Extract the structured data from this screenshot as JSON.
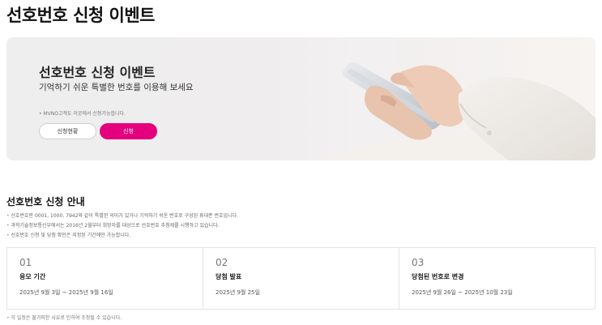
{
  "page": {
    "title": "선호번호 신청 이벤트"
  },
  "banner": {
    "title": "선호번호 신청 이벤트",
    "subtitle": "기억하기 쉬운 특별한 번호를 이용해 보세요",
    "note": "• MVNO고객도 이곳에서 신청가능합니다.",
    "status_button": "신청현황",
    "apply_button": "신청",
    "accent_color": "#e5007d"
  },
  "guide": {
    "title": "선호번호 신청 안내",
    "items": [
      "선호번호란 0001, 1000, 7942와 같이 특별한 의미가 있거나 기억하기 쉬운 번호로 구성된 휴대폰 번호입니다.",
      "과학기술정보통신부에서는 2016년 2월부터 희망자를 대상으로 선호번호 추첨제를 시행하고 있습니다.",
      "선호번호 신청 및 당첨 확인은 지정된 기간에만 가능합니다."
    ]
  },
  "steps": [
    {
      "num": "01",
      "label": "응모 기간",
      "date": "2025년 9월 3일 ~ 2025년 9월 16일"
    },
    {
      "num": "02",
      "label": "당첨 발표",
      "date": "2025년 9월 25일"
    },
    {
      "num": "03",
      "label": "당첨된 번호로 변경",
      "date": "2025년 9월 26일 ~ 2025년 10월 23일"
    }
  ],
  "footnote": "각 일정은 불가피한 사유로 인하여 조정될 수 있습니다."
}
